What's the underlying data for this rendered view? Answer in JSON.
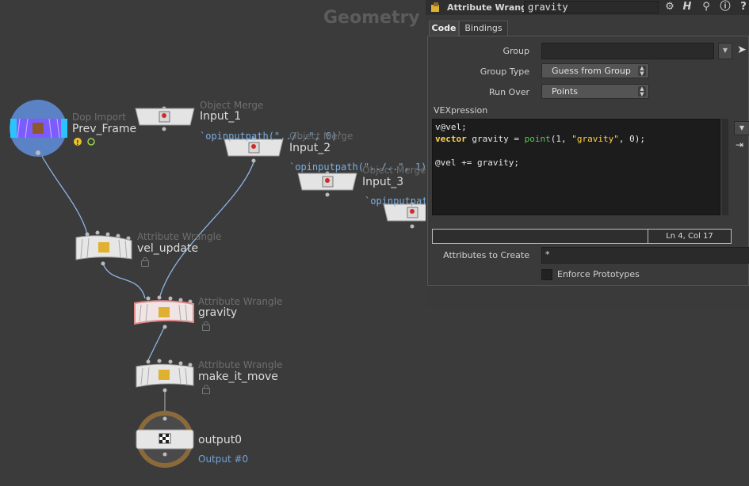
{
  "network": {
    "context_label": "Geometry",
    "nodes": {
      "dop_import": {
        "type": "Dop Import",
        "name": "Prev_Frame"
      },
      "input_1": {
        "type": "Object Merge",
        "name": "Input_1",
        "expr": "`opinputpath(\"../..\", 0)`"
      },
      "input_2": {
        "type": "Object Merge",
        "name": "Input_2",
        "expr": "`opinputpath(\"../..\", 1)`"
      },
      "input_3": {
        "type": "Object Merge",
        "name": "Input_3",
        "expr": "`opinputpath"
      },
      "vel_update": {
        "type": "Attribute Wrangle",
        "name": "vel_update"
      },
      "gravity": {
        "type": "Attribute Wrangle",
        "name": "gravity"
      },
      "make_it_move": {
        "type": "Attribute Wrangle",
        "name": "make_it_move"
      },
      "output0": {
        "name": "output0",
        "sub": "Output #0"
      }
    }
  },
  "panel": {
    "title_type": "Attribute Wrangle",
    "title_name": "gravity",
    "icons": [
      "gear-icon",
      "help-h-icon",
      "search-icon",
      "info-icon",
      "help-icon"
    ],
    "tabs": [
      "Code",
      "Bindings"
    ],
    "params": {
      "group_label": "Group",
      "group_value": "",
      "group_type_label": "Group Type",
      "group_type_value": "Guess from Group",
      "run_over_label": "Run Over",
      "run_over_value": "Points",
      "vex_label": "VEXpression",
      "status": "Ln 4, Col 17",
      "attrs_label": "Attributes to Create",
      "attrs_value": "*",
      "enforce_label": "Enforce Prototypes"
    },
    "code": {
      "line1": "v@vel;",
      "line2_kw": "vector",
      "line2_a": " gravity = ",
      "line2_fn": "point",
      "line2_b": "(1, ",
      "line2_str": "\"gravity\"",
      "line2_c": ", 0);",
      "line4": "@vel += gravity;"
    }
  },
  "colors": {
    "background": "#3b3b3b",
    "panel": "#3a3a3a",
    "selected_outline": "#e08a8a",
    "wire": "#8fb4e6",
    "dop_color": "#7d5cff",
    "output_ring": "#8a6a3a"
  }
}
